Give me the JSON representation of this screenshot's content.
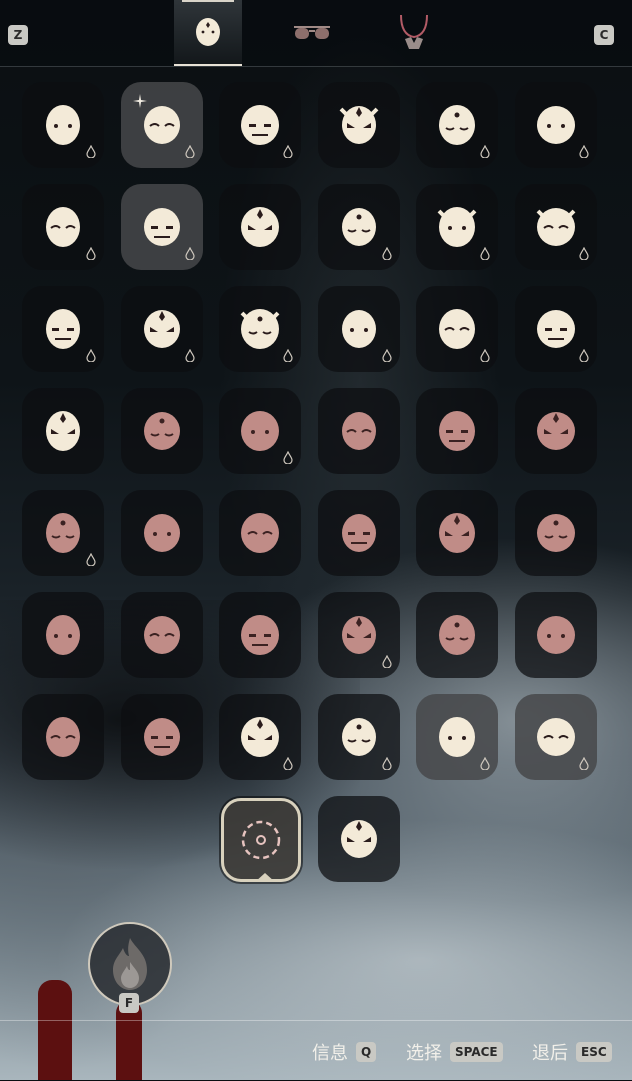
{
  "top_bar": {
    "left_key": "Z",
    "right_key": "C",
    "tabs": [
      {
        "id": "mask",
        "icon": "mask-icon",
        "active": true
      },
      {
        "id": "glasses",
        "icon": "sunglasses-icon",
        "active": false
      },
      {
        "id": "necklace",
        "icon": "necklace-icon",
        "active": false
      }
    ]
  },
  "masks": [
    {
      "icon": "dot-face-mask-icon",
      "tone": "light"
    },
    {
      "icon": "sleepy-face-mask-icon",
      "tone": "light"
    },
    {
      "icon": "stitched-face-mask-icon",
      "tone": "light"
    },
    {
      "icon": "crowned-demon-mask-icon",
      "tone": "light"
    },
    {
      "icon": "fox-mask-icon",
      "tone": "light"
    },
    {
      "icon": "bat-mask-icon",
      "tone": "light"
    },
    {
      "icon": "bandana-mask-icon",
      "tone": "light"
    },
    {
      "icon": "scarf-mask-icon",
      "tone": "light"
    },
    {
      "icon": "helmet-mask-icon",
      "tone": "light"
    },
    {
      "icon": "dragon-mask-icon",
      "tone": "light"
    },
    {
      "icon": "beetle-mask-icon",
      "tone": "light"
    },
    {
      "icon": "lion-dance-mask-icon",
      "tone": "light"
    },
    {
      "icon": "rabbit-mask-icon",
      "tone": "light"
    },
    {
      "icon": "marked-face-mask-icon",
      "tone": "light"
    },
    {
      "icon": "horned-grin-mask-icon",
      "tone": "light"
    },
    {
      "icon": "plain-face-mask-icon",
      "tone": "light"
    },
    {
      "icon": "triangle-face-mask-icon",
      "tone": "light"
    },
    {
      "icon": "stripe-face-mask-icon",
      "tone": "light"
    },
    {
      "icon": "heart-frog-mask-icon",
      "tone": "light"
    },
    {
      "icon": "bearded-mask-icon",
      "tone": "dark"
    },
    {
      "icon": "long-beard-mask-icon",
      "tone": "dark"
    },
    {
      "icon": "spiky-mask-icon",
      "tone": "dark"
    },
    {
      "icon": "smile-mask-icon",
      "tone": "dark"
    },
    {
      "icon": "dots-mask-icon",
      "tone": "dark"
    },
    {
      "icon": "horned-owl-mask-icon",
      "tone": "dark"
    },
    {
      "icon": "owl-eyes-mask-icon",
      "tone": "dark"
    },
    {
      "icon": "winged-mask-icon",
      "tone": "dark"
    },
    {
      "icon": "drowsy-mask-icon",
      "tone": "dark"
    },
    {
      "icon": "calm-mask-icon",
      "tone": "dark"
    },
    {
      "icon": "tear-lines-mask-icon",
      "tone": "dark"
    },
    {
      "icon": "closed-eyes-mask-icon",
      "tone": "dark"
    },
    {
      "icon": "swirl-cheek-mask-icon",
      "tone": "dark"
    },
    {
      "icon": "sad-lines-mask-icon",
      "tone": "dark"
    },
    {
      "icon": "mustache-mask-icon",
      "tone": "dark"
    },
    {
      "icon": "flame-mask-icon",
      "tone": "dark"
    },
    {
      "icon": "flower-mask-icon",
      "tone": "dark"
    },
    {
      "icon": "dark-eyes-mask-icon",
      "tone": "dark"
    },
    {
      "icon": "moon-mask-icon",
      "tone": "dark"
    },
    {
      "icon": "blush-mask-icon",
      "tone": "light"
    },
    {
      "icon": "bull-mask-icon",
      "tone": "light"
    },
    {
      "icon": "tiger-mask-icon",
      "tone": "light"
    },
    {
      "icon": "rose-mask-icon",
      "tone": "light"
    },
    {
      "icon": "empty-slot-mask-icon",
      "tone": "outline"
    },
    {
      "icon": "wolf-mask-icon",
      "tone": "light"
    }
  ],
  "fire_button": {
    "icon": "flame-icon",
    "key": "F"
  },
  "bottom_bar": {
    "info_label": "信息",
    "info_key": "Q",
    "select_label": "选择",
    "select_key": "SPACE",
    "back_label": "退后",
    "back_key": "ESC"
  }
}
